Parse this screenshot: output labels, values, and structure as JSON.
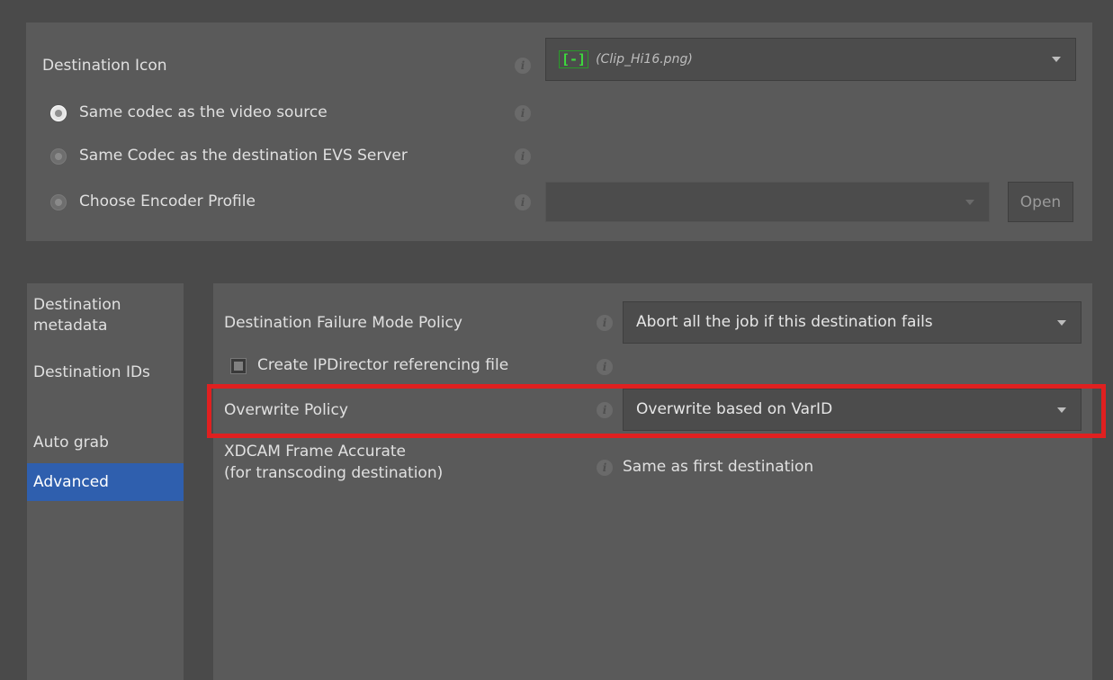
{
  "top": {
    "destination_icon_label": "Destination Icon",
    "icon_tag": "[-]",
    "icon_file": "(Clip_Hi16.png)",
    "options": [
      {
        "label": "Same codec as the video source",
        "checked": true
      },
      {
        "label": "Same Codec as the destination EVS Server",
        "checked": false
      },
      {
        "label": "Choose Encoder Profile",
        "checked": false
      }
    ],
    "encoder_profile_value": "",
    "open_label": "Open"
  },
  "sidebar": {
    "items": [
      {
        "label": "Destination metadata",
        "active": false
      },
      {
        "label": "Destination IDs",
        "active": false
      },
      {
        "label": "Auto grab",
        "active": false
      },
      {
        "label": "Advanced",
        "active": true
      }
    ]
  },
  "advanced": {
    "failure_mode_label": "Destination Failure Mode Policy",
    "failure_mode_value": "Abort all the job if this destination fails",
    "create_ipdirector_label": "Create IPDirector referencing file",
    "create_ipdirector_checked": true,
    "overwrite_label": "Overwrite Policy",
    "overwrite_value": "Overwrite based on VarID",
    "xdcam_label_line1": "XDCAM Frame Accurate",
    "xdcam_label_line2": "(for transcoding destination)",
    "xdcam_value": "Same as first destination"
  },
  "icons": {
    "info": "info-icon",
    "dropdown": "chevron-down-icon"
  },
  "colors": {
    "background": "#4a4a4a",
    "panel": "#5a5a5a",
    "active_tab": "#2f5fae",
    "highlight": "#e02020",
    "icon_green": "#3ddc3d"
  }
}
